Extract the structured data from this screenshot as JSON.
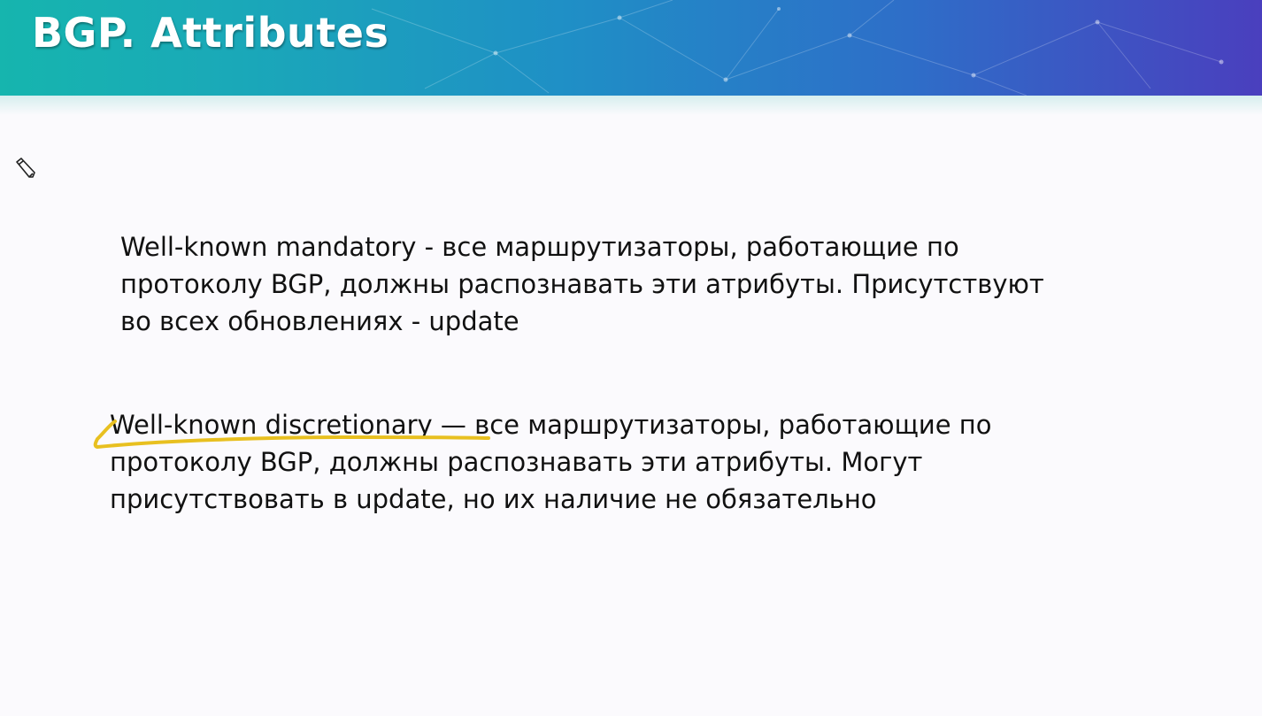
{
  "slide": {
    "title": "BGP. Attributes",
    "paragraph1": {
      "lines": [
        "Well-known mandatory - все маршрутизаторы, работающие по",
        "протоколу BGP, должны распознавать эти атрибуты. Присутствуют",
        "во всех обновлениях - update"
      ]
    },
    "paragraph2": {
      "lines": [
        "Well-known discretionary — все маршрутизаторы, работающие по",
        "протоколу BGP, должны распознавать эти атрибуты. Могут",
        "присутствовать в update, но их наличие не обязательно"
      ]
    }
  },
  "annotation": {
    "pen_icon": "pen-tool-icon",
    "highlight_color": "#e8c020"
  },
  "colors": {
    "header_start": "#16b5ae",
    "header_end": "#4a3fbe",
    "title_text": "#ffffff",
    "body_text": "#111111",
    "background": "#fbfafd"
  }
}
